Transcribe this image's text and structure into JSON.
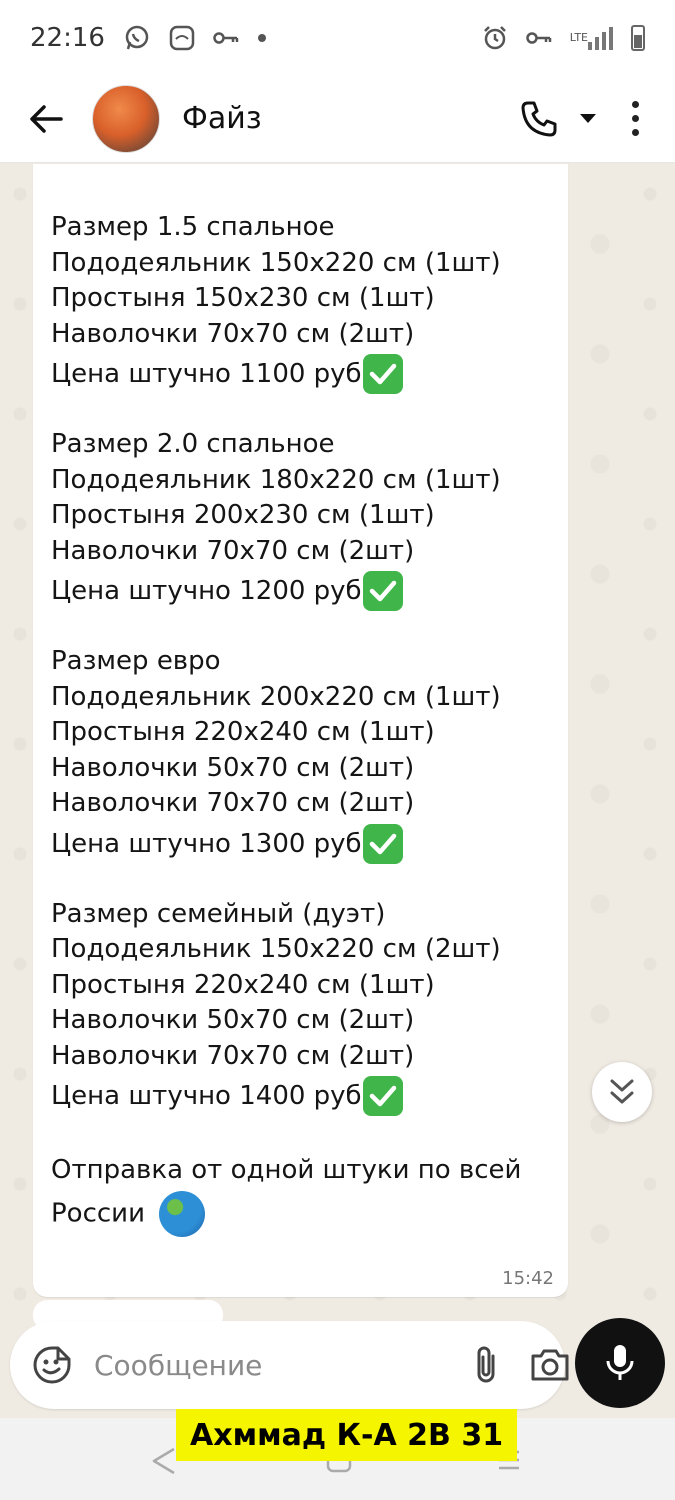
{
  "status_bar": {
    "time": "22:16",
    "network": "LTE"
  },
  "header": {
    "contact_name": "Файз"
  },
  "message": {
    "blocks": [
      {
        "lines": [
          "Размер 1.5 спальное",
          "Пододеяльник 150х220 см (1шт)",
          "Простыня 150х230 см (1шт)",
          "Наволочки 70х70 см (2шт)"
        ],
        "price": "Цена штучно 1100 руб"
      },
      {
        "lines": [
          "Размер 2.0 спальное",
          "Пододеяльник 180х220 см (1шт)",
          "Простыня 200х230 см (1шт)",
          "Наволочки 70х70 см (2шт)"
        ],
        "price": "Цена штучно 1200 руб"
      },
      {
        "lines": [
          "Размер евро",
          "Пододеяльник 200х220 см (1шт)",
          "Простыня 220х240 см (1шт)",
          "Наволочки 50х70 см (2шт)",
          "Наволочки 70х70 см (2шт)"
        ],
        "price": "Цена штучно 1300 руб"
      },
      {
        "lines": [
          "Размер семейный (дуэт)",
          "Пододеяльник 150х220 см (2шт)",
          "Простыня 220х240 см (1шт)",
          "Наволочки 50х70 см (2шт)",
          "Наволочки 70х70 см (2шт)"
        ],
        "price": "Цена штучно 1400 руб"
      }
    ],
    "footer_line1": "Отправка от одной штуки по всей",
    "footer_line2": "России",
    "time": "15:42"
  },
  "input": {
    "placeholder": "Сообщение"
  },
  "watermark": "Ахммад К-А   2В  31",
  "colors": {
    "check_green": "#3fb54a",
    "chat_background": "#efeae2",
    "watermark_yellow": "#f5f500"
  }
}
